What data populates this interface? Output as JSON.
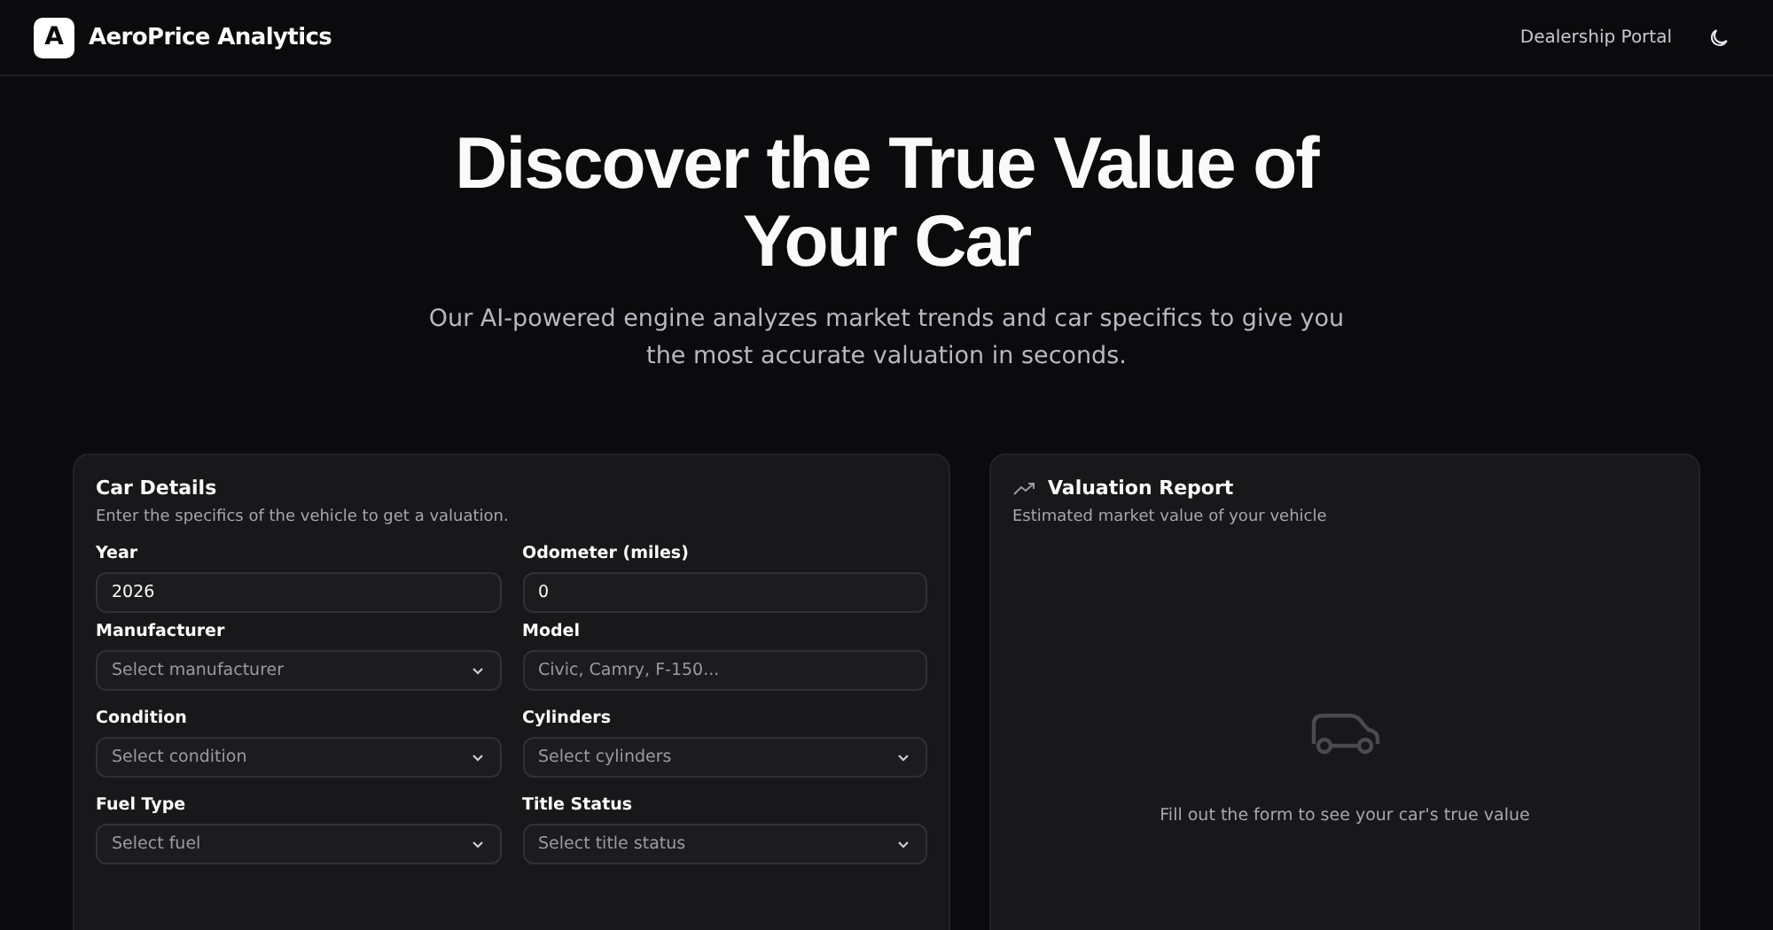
{
  "header": {
    "logo_letter": "A",
    "brand": "AeroPrice Analytics",
    "nav_link": "Dealership Portal"
  },
  "hero": {
    "title_lines": [
      "Discover the True Value of",
      "Your Car"
    ],
    "subtitle_lines": [
      "Our AI-powered engine analyzes market trends and car specifics to give you",
      "the most accurate valuation in seconds."
    ]
  },
  "form_card": {
    "title": "Car Details",
    "description": "Enter the specifics of the vehicle to get a valuation.",
    "fields": [
      {
        "label": "Year",
        "kind": "input",
        "value": "2026"
      },
      {
        "label": "Odometer (miles)",
        "kind": "input",
        "value": "0"
      },
      {
        "label": "Manufacturer",
        "kind": "select",
        "placeholder": "Select manufacturer"
      },
      {
        "label": "Model",
        "kind": "input",
        "placeholder": "Civic, Camry, F-150..."
      },
      {
        "label": "Condition",
        "kind": "select",
        "placeholder": "Select condition"
      },
      {
        "label": "Cylinders",
        "kind": "select",
        "placeholder": "Select cylinders"
      },
      {
        "label": "Fuel Type",
        "kind": "select",
        "placeholder": "Select fuel"
      },
      {
        "label": "Title Status",
        "kind": "select",
        "placeholder": "Select title status"
      }
    ]
  },
  "report_card": {
    "title": "Valuation Report",
    "description": "Estimated market value of your vehicle",
    "empty_message": "Fill out the form to see your car's true value"
  }
}
